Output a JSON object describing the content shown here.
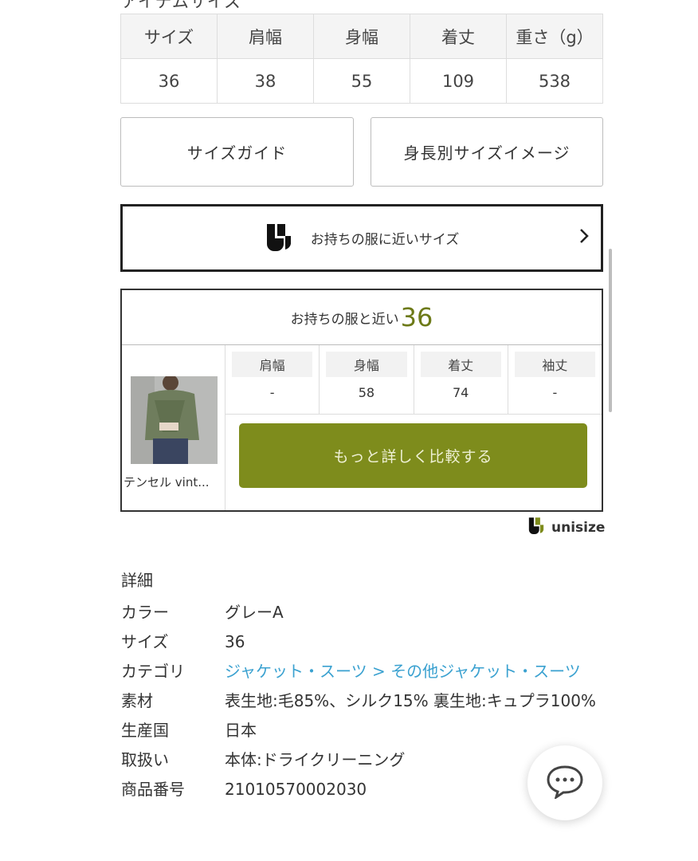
{
  "section_heading": "アイテムサイズ",
  "size_table": {
    "headers": [
      "サイズ",
      "肩幅",
      "身幅",
      "着丈",
      "重さ（g）"
    ],
    "row": [
      "36",
      "38",
      "55",
      "109",
      "538"
    ]
  },
  "buttons": {
    "size_guide": "サイズガイド",
    "height_guide": "身長別サイズイメージ"
  },
  "unisize": {
    "banner_label": "お持ちの服に近いサイズ",
    "logo_text": "unisize"
  },
  "compare": {
    "head_prefix": "お持ちの服と近い",
    "head_size": "36",
    "item_caption": "テンセル vint...",
    "columns": [
      {
        "label": "肩幅",
        "value": "-"
      },
      {
        "label": "身幅",
        "value": "58"
      },
      {
        "label": "着丈",
        "value": "74"
      },
      {
        "label": "袖丈",
        "value": "-"
      }
    ],
    "button_label": "もっと詳しく比較する"
  },
  "details": {
    "title": "詳細",
    "color_key": "カラー",
    "color_val": "グレーA",
    "size_key": "サイズ",
    "size_val": "36",
    "category_key": "カテゴリ",
    "category_link1": "ジャケット・スーツ",
    "category_sep": " > ",
    "category_link2": "その他ジャケット・スーツ",
    "material_key": "素材",
    "material_val": "表生地:毛85%、シルク15% 裏生地:キュプラ100%",
    "origin_key": "生産国",
    "origin_val": "日本",
    "care_key": "取扱い",
    "care_val": "本体:ドライクリーニング",
    "product_no_key": "商品番号",
    "product_no_val": "21010570002030"
  },
  "colors": {
    "accent_olive": "#7e8c1c",
    "link_blue": "#3aa1d0"
  }
}
